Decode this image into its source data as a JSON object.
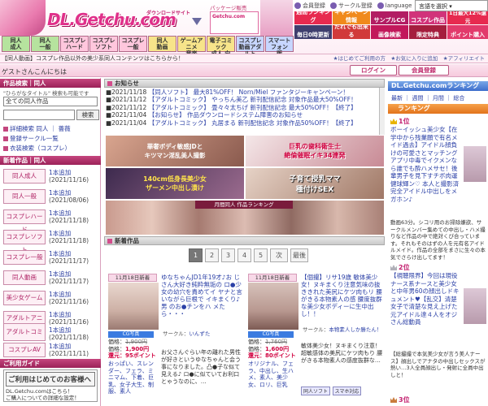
{
  "header": {
    "logo_text": "DL.Getchu.com",
    "logo_sub": "ダウンロードサイト",
    "package_label": "パッケージ販売",
    "package_box": "Getchu.com",
    "top_links": [
      "会員登録",
      "サークル登録",
      "language"
    ],
    "language_select": "言語を選択 ▾",
    "categories": [
      {
        "label": "同人\n成人",
        "color": "green"
      },
      {
        "label": "同人\n一般",
        "color": "green"
      },
      {
        "label": "コスプレ\nハード",
        "color": "pink"
      },
      {
        "label": "コスプレ\nソフト",
        "color": "pink"
      },
      {
        "label": "コスプレ\n一般",
        "color": "pink"
      },
      {
        "label": "同人\n動画",
        "color": "gold"
      },
      {
        "label": "ゲームアニメ\n音楽",
        "color": "gold"
      },
      {
        "label": "電子コミック\n成人 向",
        "color": "gold"
      },
      {
        "label": "コスプレ\n動画アダルト",
        "color": "blue"
      },
      {
        "label": "スマートフォン\n版",
        "color": "blue"
      }
    ],
    "top_banners": [
      "週間ランキング",
      "キャンペーン情報",
      "サンプルCG",
      "コスプレ作品",
      "1日最大12%還元"
    ],
    "bottom_banners": [
      "毎日0時更新",
      "だれでも出来る",
      "画像検索",
      "限定特典",
      "ポイント購入"
    ]
  },
  "infobar": {
    "text": "【同人動画】コスプレ作品以外の美少系同人コンテンツはこちらから！",
    "links": "★はじめてご利用の方　★お気に入りに追加　★アフィリエイト"
  },
  "greeting": "ゲストさんこんにちは",
  "auth": {
    "login": "ログイン",
    "register": "会員登録"
  },
  "left": {
    "search_head": "作品検索｜同人",
    "search_hint": "\"ひらがなタイトル\" 検索も可能です",
    "search_select": "全ての同人作品",
    "search_button": "検索",
    "links": [
      "詳細検索 同人 ｜ 薔薇",
      "登録サークル一覧",
      "衣装検索（コスプレ）"
    ],
    "new_head": "新着作品｜同人",
    "new_items": [
      {
        "label": "同人成人",
        "count": "1本追加",
        "date": "(2021/11/16)"
      },
      {
        "label": "同人一般",
        "count": "1本追加",
        "date": "(2021/08/06)"
      },
      {
        "label": "コスプレハード",
        "count": "1本追加",
        "date": "(2021/11/18)"
      },
      {
        "label": "コスプレソフト",
        "count": "1本追加",
        "date": "(2021/11/18)"
      },
      {
        "label": "コスプレ一般",
        "count": "1本追加",
        "date": "(2021/11/17)"
      },
      {
        "label": "同人動画",
        "count": "1本追加",
        "date": "(2021/11/17)"
      },
      {
        "label": "美少女ゲーム",
        "count": "1本追加",
        "date": "(2021/11/16)"
      },
      {
        "label": "アダルトアニメ",
        "count": "1本追加",
        "date": "(2021/11/16)"
      },
      {
        "label": "アダルトコミック",
        "count": "1本追加",
        "date": "(2021/11/18)"
      },
      {
        "label": "コスプレAV",
        "count": "1本追加",
        "date": "(2021/11/11)"
      }
    ],
    "guide_head": "ご利用ガイド",
    "guide_title": "ご利用はじめてのお客様へ",
    "guide_text": "DL.Getchu.comはこちら！\nご購入についての詳細な設定！"
  },
  "center": {
    "news_head": "お知らせ",
    "news": [
      {
        "date": "■2021/11/18",
        "text": "【同人ソフト】 最大81%OFF！ Norn/Miel ファンタジーキャンペーン！"
      },
      {
        "date": "■2021/11/12",
        "text": "【アダルトコミック】 やっちん美乙 新刊配信記念 対象作品最大50%OFF！"
      },
      {
        "date": "■2021/11/12",
        "text": "【アダルトコミック】 畳々々太ちげ 新刊配信記念 最大50%OFF！【終了】"
      },
      {
        "date": "■2021/11/04",
        "text": "【お知らせ】 作品ダウンロードシステム障害のお知らせ"
      },
      {
        "date": "■2021/11/04",
        "text": "【アダルトコミック】 丸居まる 新刊配信記念 対象作品50%OFF！【終了】"
      }
    ],
    "banners": [
      {
        "text": "華奢ボディ敏感JDと\nキツマン淫乱美人撮影"
      },
      {
        "text": "巨乳の歯科衛生士\n絶倫催眠イキ34連発"
      },
      {
        "text": "140cm低身長美少女\nザーメン中出し漬け"
      },
      {
        "text": "子育て授乳ママ\n種付けSEX"
      }
    ],
    "rank_label": "月間同人 作品ランキング",
    "new_head": "新着作品",
    "pages": [
      "1",
      "2",
      "3",
      "4",
      "5",
      "次",
      "最後"
    ],
    "products": [
      {
        "date": "11月18日新着",
        "title": "ゆなちゃんJD1年19才♪お じさん大好き純粋無垢の ロ●少女の幼穴を責めてイ ヤナと言いながら巨根で イキまくり♪男 のお●チンをハ メたら・・・",
        "circle_label": "サークル：",
        "circle": "いんずた",
        "badge": "CG写真",
        "price_label": "価格：",
        "price_orig": "1,900円",
        "price_now": "1,900円",
        "points": "還元：95ポイント",
        "tags": "おっぱい、スレンダー、フェラ、ミニマム、下着、巨乳、女子大生、制服、素人",
        "desc": "お父さんぐらい年の離れた男性が好きというゆなちゃんと会う事になりました。凸●子な似て見える♪ ロ●に似ていてお利口とゃうなのに、…"
      },
      {
        "date": "11月18日新着",
        "title": "【個撮】リサ19歳 敏体美少女！ヌキまくり注意気味の抜ききれた美尻にケツ肉もリ 腰がきる本物素人の感 腰度抜群な美少女ボディーに生中出し！！",
        "circle_label": "サークル：",
        "circle": "本物素人しか勝たん！",
        "badge": "CG写真",
        "price_label": "価格：",
        "price_orig": "1,760円",
        "price_now": "1,600円",
        "points": "還元：80ポイント",
        "tags": "オリジナル、フェラ、中出し、生ハメ、素人、美少女、ロリ、巨乳",
        "desc": "敏体美少女！ヌキまくり注意！超敏感体の美尻にケツ肉もり 腰がきる本物素人の感度抜群な…",
        "chips": [
          "同人ソフト",
          "スマホ対応"
        ]
      }
    ]
  },
  "right": {
    "head": "DL.Getchu.comランキング",
    "tabs": "最新 ｜ 週間 ｜ 月間 ｜ 総合",
    "rank_head": "ランキング",
    "ranks": [
      {
        "num": "1位",
        "title": "ボーイッシュ美少女【在学中から残業願で有名メイド過去】アイドル顔負けの可愛さとマッチングアプリ中毒でイクメンなら誰でも酔ハメサセ！後輩男子を見下すチボ肉運健球輝ン♡ 本人と撮影済 完全アイドル中出しをメガホン♪",
        "info": "動画63分。シコリ用のお掃除嫌欲、サークルメンバー集めての中出し・ハメ撮りなど作品の中で絶対くぴ合っています。それもそのはずの人を元有名アイドルメイド。作品の全部をまさに生々の本気でさらけ出してます！"
      },
      {
        "num": "2位",
        "title": "【視聴限界】今回は現役ナース系ナースと美少女と中年男60の顔出しドキュメント♥【乱交】清楚女子で清楚な見え上げた元アイドル達４人をオジさん総動員",
        "info": "【総撮撮で本気美少女が言う美人ナース】顔出しでアナタの中出しセックスが熱い…3人全員顔出し・発射に全員中出しと！"
      },
      {
        "num": "3位",
        "title": "",
        "info": ""
      }
    ]
  }
}
